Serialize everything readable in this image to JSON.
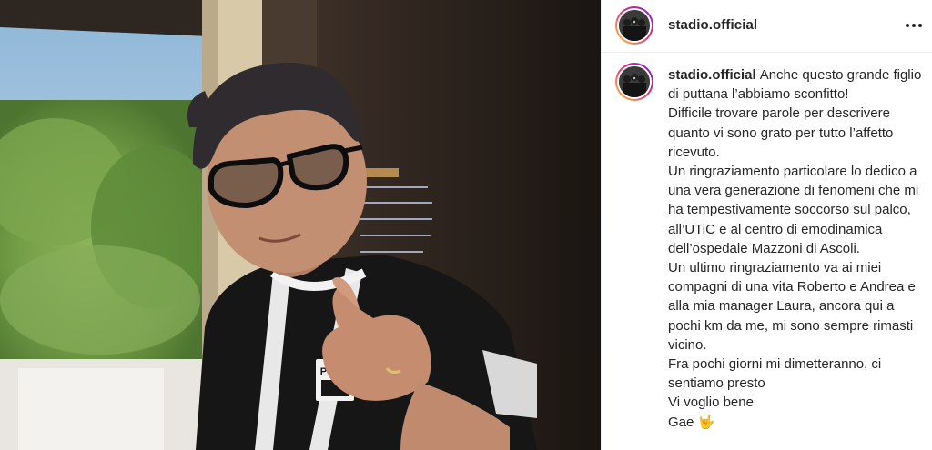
{
  "post": {
    "username": "stadio.official",
    "avatar_icon": "band-avatar-icon",
    "more_icon": "more-options-icon"
  },
  "caption": {
    "username": "stadio.official",
    "text": "Anche questo grande figlio di puttana l’abbiamo sconfitto!\nDifficile trovare parole per descrivere quanto vi sono grato per tutto l’affetto ricevuto.\nUn ringraziamento particolare lo dedico a una vera generazione di fenomeni che mi ha tempestivamente soccorso sul palco, all’UTiC e al centro di emodinamica dell’ospedale Mazzoni di Ascoli.\nUn ultimo ringraziamento va ai miei compagni di una vita Roberto e Andrea e alla mia manager Laura, ancora qui a pochi km da me, mi sono sempre rimasti vicino.\nFra pochi giorni mi dimetteranno, ci sentiamo presto\nVi voglio bene\nGae 🤟"
  },
  "photo": {
    "shirt_logo": "PUMA"
  },
  "colors": {
    "text": "#262626",
    "ring_start": "#f9ce34",
    "ring_mid": "#ee2a7b",
    "ring_end": "#6228d7"
  }
}
